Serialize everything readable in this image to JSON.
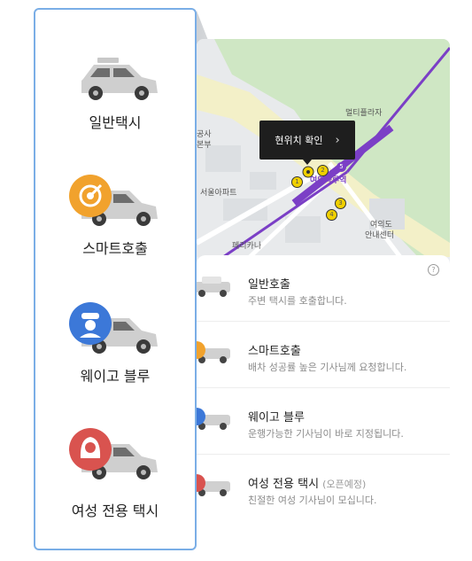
{
  "left_menu": {
    "items": [
      {
        "label": "일반택시",
        "icon": "taxi-icon"
      },
      {
        "label": "스마트호출",
        "icon": "target-icon",
        "badge_color": "#f1a22d"
      },
      {
        "label": "웨이고 블루",
        "icon": "chauffeur-icon",
        "badge_color": "#3c78d8"
      },
      {
        "label": "여성 전용 택시",
        "icon": "woman-icon",
        "badge_color": "#d9534f"
      }
    ]
  },
  "map": {
    "labels": {
      "plaza": "멀티플라자",
      "gong": "공사",
      "bonbu": "본부",
      "apt": "서울아파트",
      "station": "여의나루역",
      "ferrari": "페리카나",
      "info1": "여의도",
      "info2": "안내센터"
    },
    "exits": [
      "1",
      "2",
      "3",
      "4",
      "5"
    ],
    "line_color": "#7b3fc6",
    "popup_label": "현위치 확인"
  },
  "sheet": {
    "help": "?",
    "options": [
      {
        "title": "일반호출",
        "subtitle": "",
        "desc": "주변 택시를 호출합니다."
      },
      {
        "title": "스마트호출",
        "subtitle": "",
        "desc": "배차 성공률 높은 기사님께 요청합니다."
      },
      {
        "title": "웨이고 블루",
        "subtitle": "",
        "desc": "운행가능한 기사님이 바로 지정됩니다."
      },
      {
        "title": "여성 전용 택시",
        "subtitle": "(오픈예정)",
        "desc": "친절한 여성 기사님이 모십니다."
      }
    ]
  },
  "colors": {
    "card_border": "#7aaee6",
    "target": "#f1a22d",
    "blue": "#3c78d8",
    "red": "#d9534f"
  }
}
